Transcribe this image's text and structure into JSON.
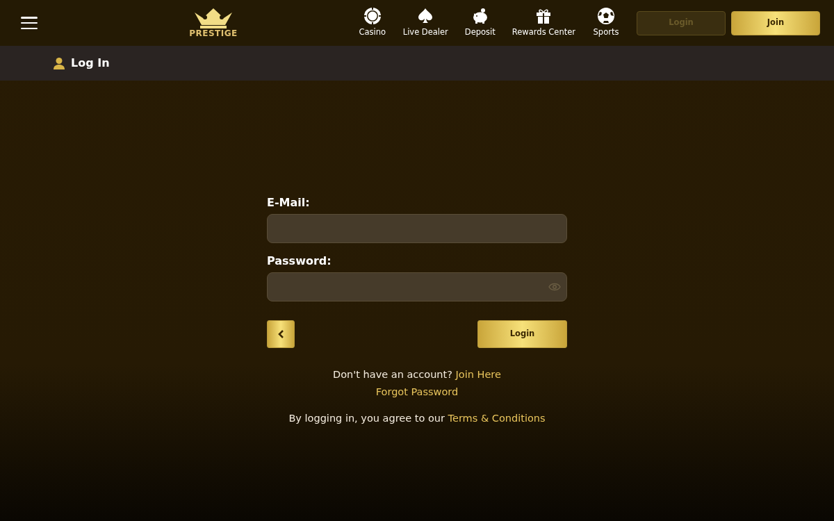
{
  "header": {
    "logo_text": "PRESTIGE",
    "nav": [
      {
        "kind": "chip",
        "label": "Casino"
      },
      {
        "kind": "spade",
        "label": "Live Dealer"
      },
      {
        "kind": "piggy",
        "label": "Deposit"
      },
      {
        "kind": "gift",
        "label": "Rewards Center"
      },
      {
        "kind": "ball",
        "label": "Sports"
      }
    ],
    "buttons": [
      {
        "label": "Login",
        "disabled": true
      },
      {
        "label": "Join",
        "disabled": false
      }
    ]
  },
  "page_title": "Log In",
  "form": {
    "fields": [
      {
        "label": "E-Mail:",
        "kind": "text"
      },
      {
        "label": "Password:",
        "kind": "password"
      }
    ],
    "submit": "Login",
    "signup_prompt": "Don't have an account?",
    "signup_link": "Join Here",
    "forgot_link": "Forgot Password",
    "terms_text": "By logging in, you agree to our",
    "terms_link": "Terms & Conditions"
  }
}
